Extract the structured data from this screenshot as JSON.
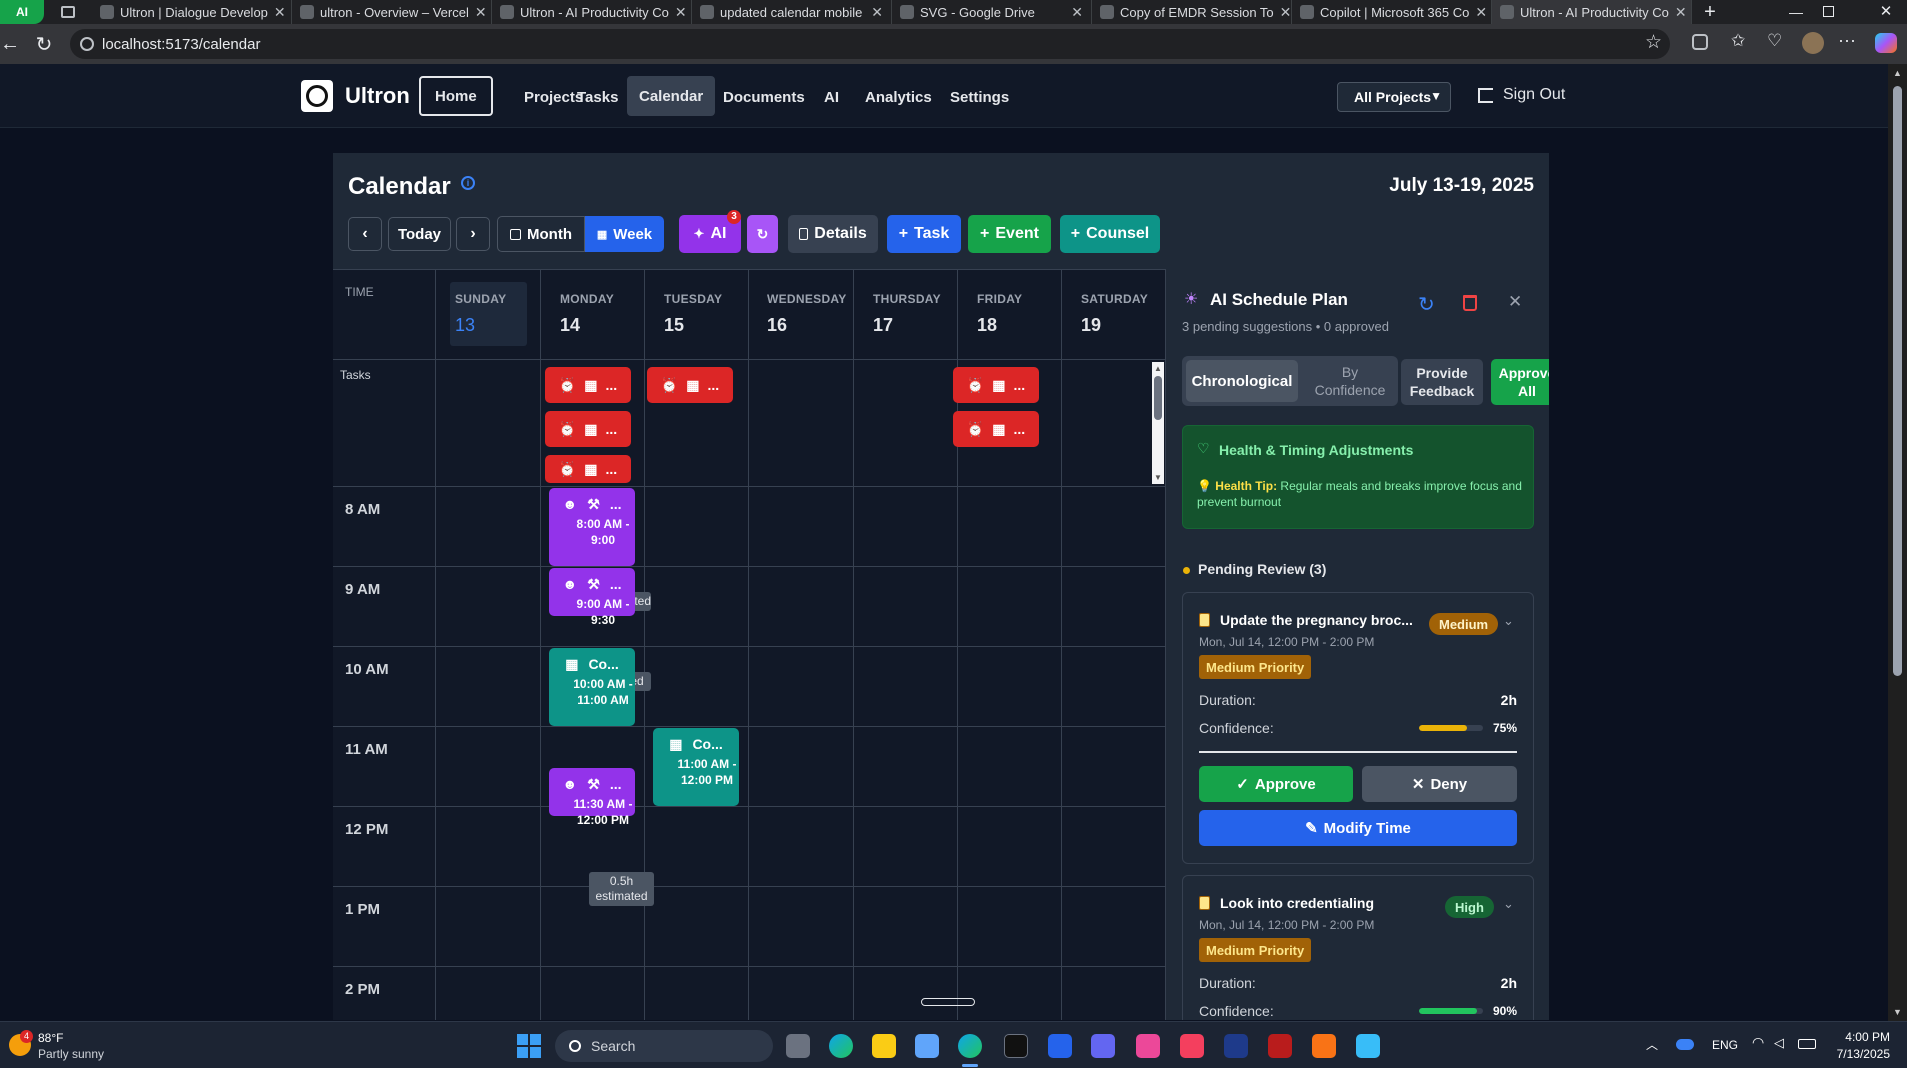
{
  "browser": {
    "tabs": [
      {
        "label": "Ultron | Dialogue Develop"
      },
      {
        "label": "ultron - Overview – Vercel"
      },
      {
        "label": "Ultron - AI Productivity Co"
      },
      {
        "label": "updated calendar mobile"
      },
      {
        "label": "SVG - Google Drive"
      },
      {
        "label": "Copy of EMDR Session To"
      },
      {
        "label": "Copilot | Microsoft 365 Co"
      },
      {
        "label": "Ultron - AI Productivity Co"
      }
    ],
    "ai_chip": "AI",
    "url": "localhost:5173/calendar"
  },
  "header": {
    "brand": "Ultron",
    "nav": [
      "Home",
      "Projects",
      "Tasks",
      "Calendar",
      "Documents",
      "AI",
      "Analytics",
      "Settings"
    ],
    "active_nav": "Calendar",
    "project_select": "All Projects",
    "sign_out": "Sign Out"
  },
  "calendar": {
    "title": "Calendar",
    "date_range": "July 13-19, 2025",
    "toolbar": {
      "today": "Today",
      "month": "Month",
      "week": "Week",
      "ai": "AI",
      "ai_count": "3",
      "details": "Details",
      "task": "Task",
      "event": "Event",
      "counsel": "Counsel"
    },
    "time_label": "TIME",
    "tasks_label": "Tasks",
    "days": [
      {
        "name": "SUNDAY",
        "num": "13"
      },
      {
        "name": "MONDAY",
        "num": "14"
      },
      {
        "name": "TUESDAY",
        "num": "15"
      },
      {
        "name": "WEDNESDAY",
        "num": "16"
      },
      {
        "name": "THURSDAY",
        "num": "17"
      },
      {
        "name": "FRIDAY",
        "num": "18"
      },
      {
        "name": "SATURDAY",
        "num": "19"
      }
    ],
    "task_chip_text": "...",
    "hours": [
      "8 AM",
      "9 AM",
      "10 AM",
      "11 AM",
      "12 PM",
      "1 PM",
      "2 PM"
    ],
    "events": [
      {
        "title": "...",
        "time": "8:00 AM - 9:00"
      },
      {
        "title": "...",
        "time": "9:00 AM - 9:30"
      },
      {
        "title": "Co...",
        "time": "10:00 AM - 11:00 AM"
      },
      {
        "title": "Co...",
        "time": "11:00 AM - 12:00 PM"
      },
      {
        "title": "...",
        "time": "11:30 AM - 12:00 PM"
      }
    ],
    "estimates": [
      "estimated",
      "ed",
      "0.5h estimated"
    ]
  },
  "ai_panel": {
    "title": "AI Schedule Plan",
    "subtitle": "3 pending suggestions • 0 approved",
    "sort_tabs": [
      "Chronological",
      "By Confidence",
      "Provide Feedback",
      "Approve All"
    ],
    "health": {
      "title": "Health & Timing Adjustments",
      "tip_label": "Health Tip:",
      "tip_text": "Regular meals and breaks improve focus and prevent burnout"
    },
    "pending_label": "Pending Review (3)",
    "suggestions": [
      {
        "title": "Update the pregnancy broc...",
        "priority_badge": "Medium",
        "when": "Mon, Jul 14, 12:00 PM - 2:00 PM",
        "priority_pill": "Medium Priority",
        "duration_label": "Duration:",
        "duration": "2h",
        "confidence_label": "Confidence:",
        "confidence": "75%",
        "confidence_value": 0.75,
        "approve": "Approve",
        "deny": "Deny",
        "modify": "Modify Time"
      },
      {
        "title": "Look into credentialing",
        "priority_badge": "High",
        "when": "Mon, Jul 14, 12:00 PM - 2:00 PM",
        "priority_pill": "Medium Priority",
        "duration_label": "Duration:",
        "duration": "2h",
        "confidence_label": "Confidence:",
        "confidence": "90%",
        "confidence_value": 0.9
      }
    ]
  },
  "taskbar": {
    "weather_temp": "88°F",
    "weather_desc": "Partly sunny",
    "weather_badge": "4",
    "search": "Search",
    "lang": "ENG",
    "time": "4:00 PM",
    "date": "7/13/2025"
  },
  "colors": {
    "task_red": "#dc2626",
    "event_purple": "#9333ea",
    "event_teal": "#0d9488",
    "primary_blue": "#2563eb",
    "success_green": "#16a34a",
    "medium_amber": "#a16207"
  }
}
